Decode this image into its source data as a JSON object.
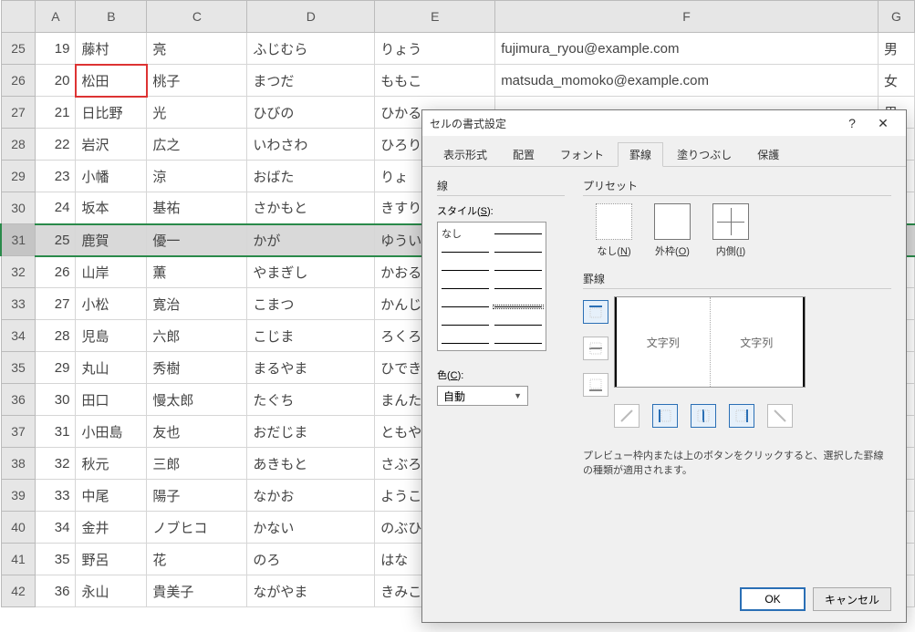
{
  "columns": [
    "",
    "A",
    "B",
    "C",
    "D",
    "E",
    "F",
    "G"
  ],
  "selected_row_index": 6,
  "redbox_cell": {
    "row": 1,
    "col": 2
  },
  "rows": [
    {
      "head": "25",
      "cells": [
        "19",
        "藤村",
        "亮",
        "ふじむら",
        "りょう",
        "fujimura_ryou@example.com",
        "男"
      ]
    },
    {
      "head": "26",
      "cells": [
        "20",
        "松田",
        "桃子",
        "まつだ",
        "ももこ",
        "matsuda_momoko@example.com",
        "女"
      ]
    },
    {
      "head": "27",
      "cells": [
        "21",
        "日比野",
        "光",
        "ひびの",
        "ひかる",
        "",
        "男"
      ]
    },
    {
      "head": "28",
      "cells": [
        "22",
        "岩沢",
        "広之",
        "いわさわ",
        "ひろり",
        "",
        ""
      ]
    },
    {
      "head": "29",
      "cells": [
        "23",
        "小幡",
        "涼",
        "おばた",
        "りょ",
        "",
        ""
      ]
    },
    {
      "head": "30",
      "cells": [
        "24",
        "坂本",
        "基祐",
        "さかもと",
        "きすり",
        "",
        ""
      ]
    },
    {
      "head": "31",
      "cells": [
        "25",
        "鹿賀",
        "優一",
        "かが",
        "ゆうい",
        "",
        ""
      ]
    },
    {
      "head": "32",
      "cells": [
        "26",
        "山岸",
        "薫",
        "やまぎし",
        "かおる",
        "",
        ""
      ]
    },
    {
      "head": "33",
      "cells": [
        "27",
        "小松",
        "寛治",
        "こまつ",
        "かんじ",
        "",
        ""
      ]
    },
    {
      "head": "34",
      "cells": [
        "28",
        "児島",
        "六郎",
        "こじま",
        "ろくろ",
        "",
        ""
      ]
    },
    {
      "head": "35",
      "cells": [
        "29",
        "丸山",
        "秀樹",
        "まるやま",
        "ひでき",
        "",
        ""
      ]
    },
    {
      "head": "36",
      "cells": [
        "30",
        "田口",
        "慢太郎",
        "たぐち",
        "まんた",
        "",
        ""
      ]
    },
    {
      "head": "37",
      "cells": [
        "31",
        "小田島",
        "友也",
        "おだじま",
        "ともや",
        "",
        ""
      ]
    },
    {
      "head": "38",
      "cells": [
        "32",
        "秋元",
        "三郎",
        "あきもと",
        "さぶろ",
        "",
        ""
      ]
    },
    {
      "head": "39",
      "cells": [
        "33",
        "中尾",
        "陽子",
        "なかお",
        "ようこ",
        "",
        ""
      ]
    },
    {
      "head": "40",
      "cells": [
        "34",
        "金井",
        "ノブヒコ",
        "かない",
        "のぶひ",
        "",
        ""
      ]
    },
    {
      "head": "41",
      "cells": [
        "35",
        "野呂",
        "花",
        "のろ",
        "はな",
        "",
        ""
      ]
    },
    {
      "head": "42",
      "cells": [
        "36",
        "永山",
        "貴美子",
        "ながやま",
        "きみこ",
        "",
        ""
      ]
    }
  ],
  "dialog": {
    "title": "セルの書式設定",
    "help_symbol": "?",
    "close_symbol": "✕",
    "tabs": [
      "表示形式",
      "配置",
      "フォント",
      "罫線",
      "塗りつぶし",
      "保護"
    ],
    "active_tab": 3,
    "line_group_label": "線",
    "style_label": "スタイル(S):",
    "style_none": "なし",
    "color_label": "色(C):",
    "color_value": "自動",
    "preset_group_label": "プリセット",
    "presets": {
      "none": "なし(N)",
      "outline": "外枠(O)",
      "inside": "内側(I)"
    },
    "border_group_label": "罫線",
    "preview_text": "文字列",
    "hint": "プレビュー枠内または上のボタンをクリックすると、選択した罫線の種類が適用されます。",
    "ok": "OK",
    "cancel": "キャンセル"
  }
}
